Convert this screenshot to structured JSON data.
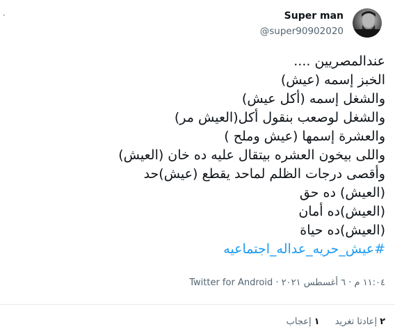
{
  "menu": {
    "icon": "more-dot-icon",
    "glyph": "·"
  },
  "author": {
    "name": "Super man",
    "handle": "@super90902020",
    "avatar_icon": "avatar-photo"
  },
  "tweet": {
    "lines": [
      "عندالمصريين ....",
      "الخبز إسمه (عيش)",
      "والشغل إسمه (أكل عيش)",
      "والشغل لوصعب بنقول أكل(العيش مر)",
      "والعشرة إسمها (عيش وملح )",
      "واللى بيخون العشره بيتقال عليه ده خان (العيش)",
      "وأقصى درجات الظلم لماحد يقطع (عيش)حد",
      "(العيش) ده حق",
      " (العيش)ده أمان",
      "(العيش)ده حياة"
    ],
    "hashtag": "#عيش_حريه_عداله_اجتماعيه"
  },
  "meta": {
    "time": "١١:٠٤ م",
    "separator": "·",
    "date": "٦ أغسطس ٢٠٢١",
    "client": "Twitter for Android"
  },
  "stats": {
    "retweets_count": "٢",
    "retweets_label": "إعادتا تغريد",
    "likes_count": "١",
    "likes_label": "إعجاب"
  },
  "colors": {
    "accent": "#1d9bf0",
    "text": "#0f1419",
    "secondary": "#536471",
    "divider": "#e6ecf0"
  }
}
